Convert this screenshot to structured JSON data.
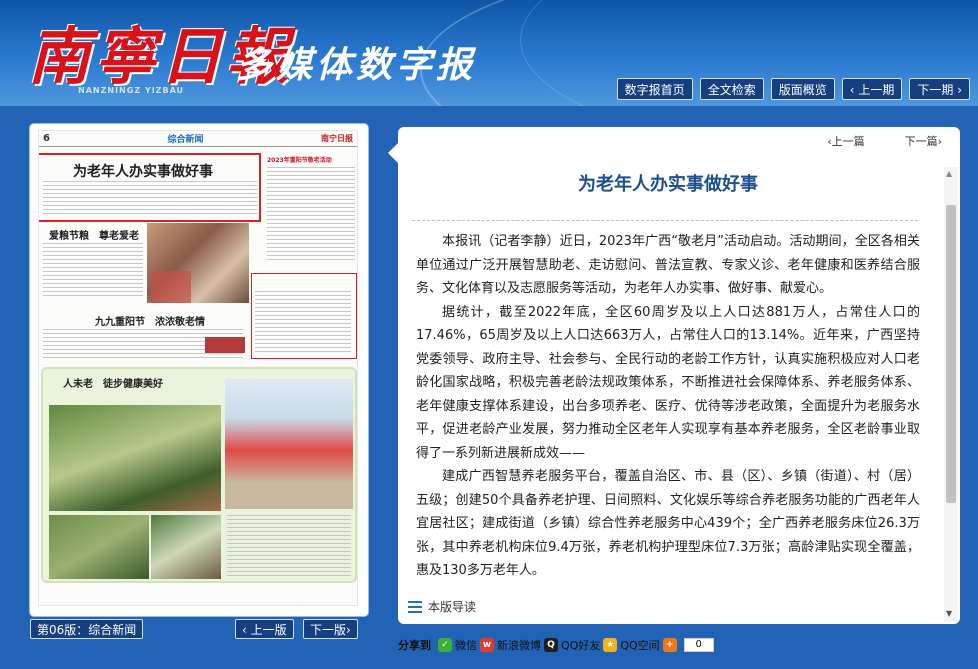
{
  "header": {
    "logo_main": "南寧日報",
    "logo_pinyin": "NANZNINGZ YIZBAU",
    "logo_sub": "多媒体数字报"
  },
  "nav": {
    "home": "数字报首页",
    "search": "全文检索",
    "overview": "版面概览",
    "prev_issue": "上一期",
    "next_issue": "下一期"
  },
  "paper": {
    "page_no": "6",
    "section": "综合新闻",
    "logo": "南宁日报",
    "headline_main": "为老年人办实事做好事",
    "headline_2": "爱粮节粮　尊老爱老",
    "headline_3": "九九重阳节　浓浓敬老情",
    "headline_4": "2023年重阳节敬老活动",
    "headline_5": "人未老　徒步健康美好"
  },
  "page_nav": {
    "page_label": "第06版：综合新闻",
    "prev_page": "上一版",
    "next_page": "下一版"
  },
  "article": {
    "prev": "上一篇",
    "next": "下一篇",
    "title": "为老年人办实事做好事",
    "paragraphs": [
      "本报讯（记者李静）近日，2023年广西“敬老月”活动启动。活动期间，全区各相关单位通过广泛开展智慧助老、走访慰问、普法宣教、专家义诊、老年健康和医养结合服务、文化体育以及志愿服务等活动，为老年人办实事、做好事、献爱心。",
      "据统计，截至2022年底，全区60周岁及以上人口达881万人，占常住人口的17.46%，65周岁及以上人口达663万人，占常住人口的13.14%。近年来，广西坚持党委领导、政府主导、社会参与、全民行动的老龄工作方针，认真实施积极应对人口老龄化国家战略，积极完善老龄法规政策体系，不断推进社会保障体系、养老服务体系、老年健康支撑体系建设，出台多项养老、医疗、优待等涉老政策，全面提升为老服务水平，促进老龄产业发展，努力推动全区老年人实现享有基本养老服务，全区老龄事业取得了一系列新进展新成效——",
      "建成广西智慧养老服务平台，覆盖自治区、市、县（区）、乡镇（街道）、村（居）五级；创建50个具备养老护理、日间照料、文化娱乐等综合养老服务功能的广西老年人宜居社区；建成街道（乡镇）综合性养老服务中心439个；全广西养老服务床位26.3万张，其中养老机构床位9.4万张，养老机构护理型床位7.3万张；高龄津贴实现全覆盖，惠及130多万老年人。"
    ],
    "guide": "本版导读"
  },
  "share": {
    "label": "分享到",
    "wechat": "微信",
    "weibo": "新浪微博",
    "qq_friend": "QQ好友",
    "qq_zone": "QQ空间",
    "count": "0"
  },
  "colors": {
    "brand_red": "#d8121a",
    "nav_button": "#163f82",
    "background": "#2263b6",
    "title_blue": "#1d4f8e"
  }
}
